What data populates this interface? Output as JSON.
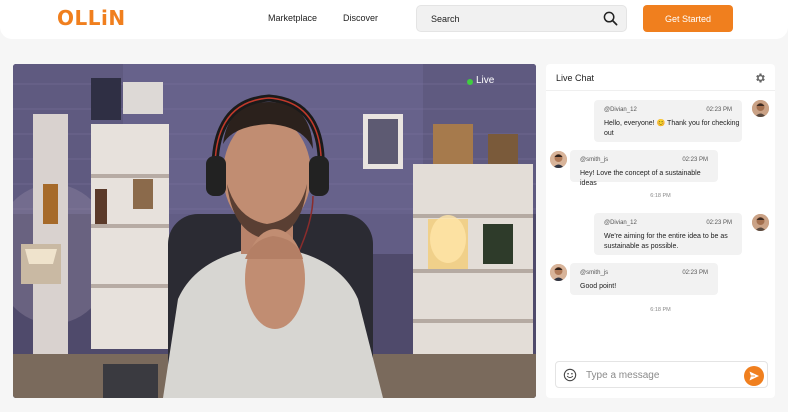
{
  "brand": {
    "logo_text": "OLLiN",
    "accent": "#f07f1e"
  },
  "nav": {
    "marketplace": "Marketplace",
    "discover": "Discover"
  },
  "search": {
    "placeholder": "Search"
  },
  "cta": {
    "label": "Get Started"
  },
  "video": {
    "live_label": "Live",
    "live_color": "#3fce3f"
  },
  "chat": {
    "title": "Live Chat",
    "messages": [
      {
        "user": "@Divian_12",
        "time": "02:23 PM",
        "text_lines": [
          "Hello, everyone! 😊 Thank you for checking",
          "out"
        ]
      },
      {
        "user": "@smith_js",
        "time": "02:23 PM",
        "text_lines": [
          "Hey! Love the concept of a sustainable ideas"
        ]
      },
      {
        "user": "@Divian_12",
        "time": "02:23 PM",
        "text_lines": [
          "We're aiming for the entire idea to be as",
          "sustainable as possible."
        ]
      },
      {
        "user": "@smith_js",
        "time": "02:23 PM",
        "text_lines": [
          "Good point!"
        ]
      }
    ],
    "separators": [
      "6:18 PM",
      "6:18 PM"
    ],
    "composer_placeholder": "Type a message"
  }
}
